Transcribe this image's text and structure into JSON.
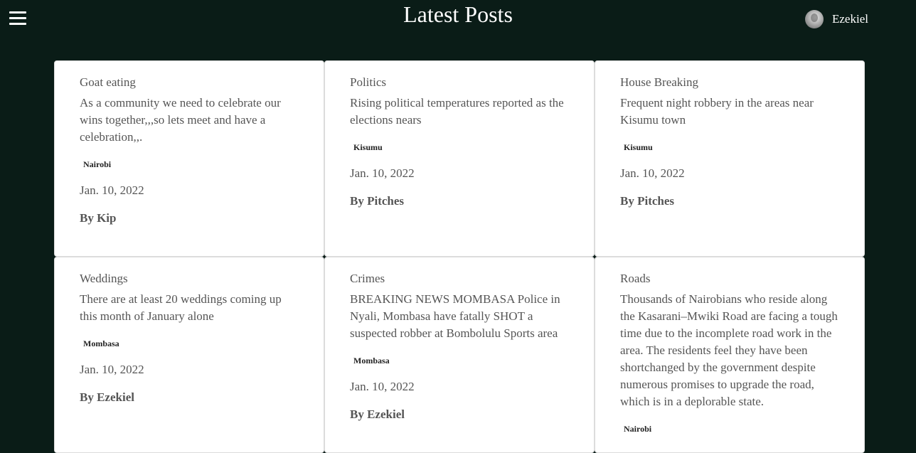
{
  "header": {
    "title": "Latest Posts",
    "user_name": "Ezekiel",
    "menu_icon": "hamburger-menu-icon",
    "avatar_icon": "user-avatar"
  },
  "posts": [
    {
      "category": "Goat eating",
      "description": "As a community we need to celebrate our wins together,,,so lets meet and have a celebration,,.",
      "location": "Nairobi",
      "date": "Jan. 10, 2022",
      "author": "By Kip"
    },
    {
      "category": "Politics",
      "description": "Rising political temperatures reported as the elections nears",
      "location": "Kisumu",
      "date": "Jan. 10, 2022",
      "author": "By Pitches"
    },
    {
      "category": "House Breaking",
      "description": "Frequent night robbery in the areas near Kisumu town",
      "location": "Kisumu",
      "date": "Jan. 10, 2022",
      "author": "By Pitches"
    },
    {
      "category": "Weddings",
      "description": "There are at least 20 weddings coming up this month of January alone",
      "location": "Mombasa",
      "date": "Jan. 10, 2022",
      "author": "By Ezekiel"
    },
    {
      "category": "Crimes",
      "description": "BREAKING NEWS MOMBASA Police in Nyali, Mombasa have fatally SHOT a suspected robber at Bombolulu Sports area",
      "location": "Mombasa",
      "date": "Jan. 10, 2022",
      "author": "By Ezekiel"
    },
    {
      "category": "Roads",
      "description": "Thousands of Nairobians who reside along the Kasarani–Mwiki Road are facing a tough time due to the incomplete road work in the area. The residents feel they have been shortchanged by the government despite numerous promises to upgrade the road, which is in a deplorable state.",
      "location": "Nairobi",
      "date": "",
      "author": ""
    }
  ]
}
